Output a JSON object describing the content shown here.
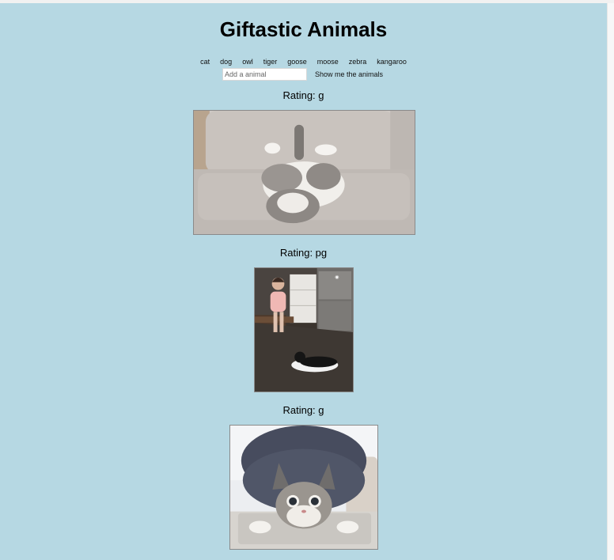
{
  "header": {
    "title": "Giftastic Animals"
  },
  "animal_buttons": [
    "cat",
    "dog",
    "owl",
    "tiger",
    "goose",
    "moose",
    "zebra",
    "kangaroo"
  ],
  "form": {
    "input_placeholder": "Add a animal",
    "input_value": "",
    "submit_label": "Show me the animals"
  },
  "results": [
    {
      "rating": "Rating: g",
      "image": "cat-lying-on-back-on-couch-gif"
    },
    {
      "rating": "Rating: pg",
      "image": "toddler-and-cat-in-kitchen-gif"
    },
    {
      "rating": "Rating: g",
      "image": "crouching-tabby-cat-gif"
    }
  ]
}
